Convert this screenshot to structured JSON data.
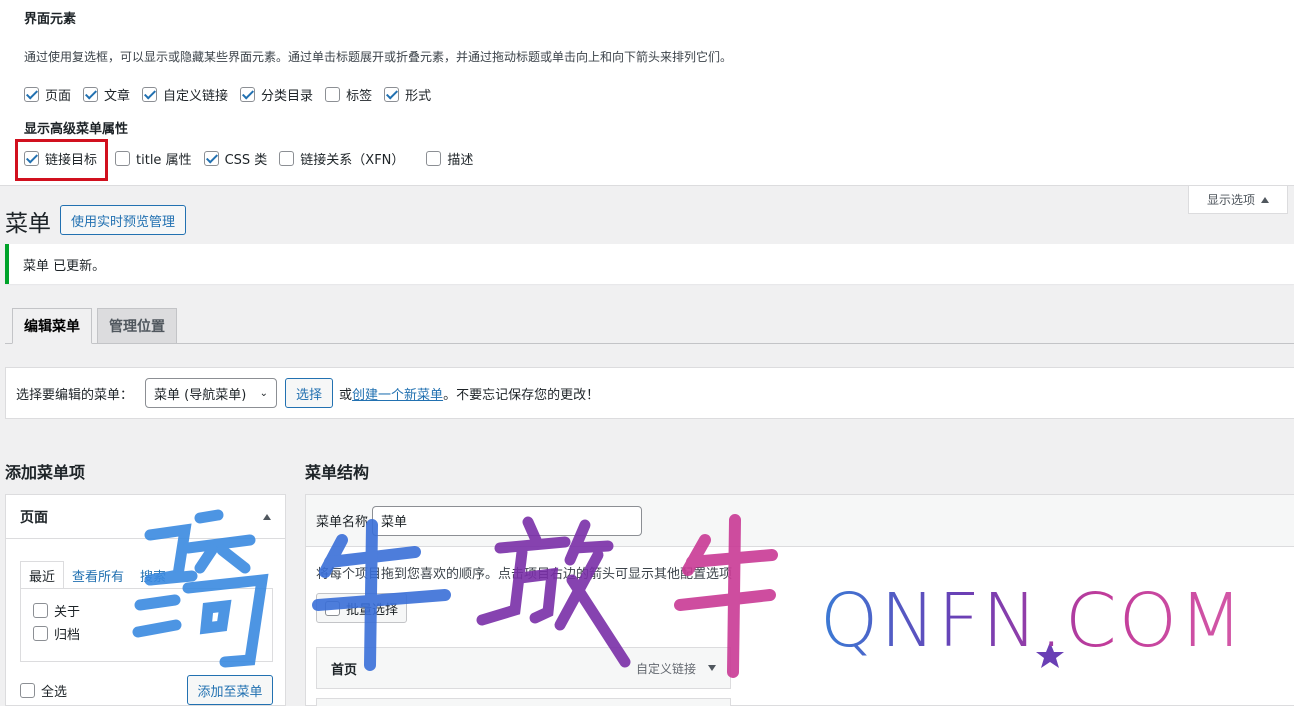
{
  "screen_options": {
    "heading": "界面元素",
    "description": "通过使用复选框，可以显示或隐藏某些界面元素。通过单击标题展开或折叠元素，并通过拖动标题或单击向上和向下箭头来排列它们。",
    "elements": [
      {
        "label": "页面",
        "checked": true
      },
      {
        "label": "文章",
        "checked": true
      },
      {
        "label": "自定义链接",
        "checked": true
      },
      {
        "label": "分类目录",
        "checked": true
      },
      {
        "label": "标签",
        "checked": false
      },
      {
        "label": "形式",
        "checked": true
      }
    ],
    "advanced_heading": "显示高级菜单属性",
    "advanced": [
      {
        "label": "链接目标",
        "checked": true
      },
      {
        "label": "title 属性",
        "checked": false
      },
      {
        "label": "CSS 类",
        "checked": true
      },
      {
        "label": "链接关系（XFN）",
        "checked": false
      },
      {
        "label": "描述",
        "checked": false
      }
    ],
    "toggle_label": "显示选项"
  },
  "header": {
    "title": "菜单",
    "live_preview_button": "使用实时预览管理"
  },
  "notice": {
    "text": "菜单 已更新。"
  },
  "tabs": [
    {
      "label": "编辑菜单",
      "active": true
    },
    {
      "label": "管理位置",
      "active": false
    }
  ],
  "select_bar": {
    "label": "选择要编辑的菜单：",
    "selected": "菜单 (导航菜单)",
    "select_button": "选择",
    "or_text": "或",
    "create_link": "创建一个新菜单",
    "reminder": "。不要忘记保存您的更改！"
  },
  "add_items": {
    "heading": "添加菜单项",
    "panel_title": "页面",
    "tabs": [
      "最近",
      "查看所有",
      "搜索"
    ],
    "items": [
      "关于",
      "归档"
    ],
    "select_all": "全选",
    "add_button": "添加至菜单"
  },
  "structure": {
    "heading": "菜单结构",
    "name_label": "菜单名称",
    "name_value": "菜单",
    "description": "将每个项目拖到您喜欢的顺序。点击项目右边的箭头可显示其他配置选项",
    "bulk_select": "批量选择",
    "items": [
      {
        "title": "首页",
        "type": "自定义链接"
      }
    ]
  },
  "watermark": {
    "cn_text": "骑牛放牛",
    "en_text": "QNFN.COM"
  }
}
